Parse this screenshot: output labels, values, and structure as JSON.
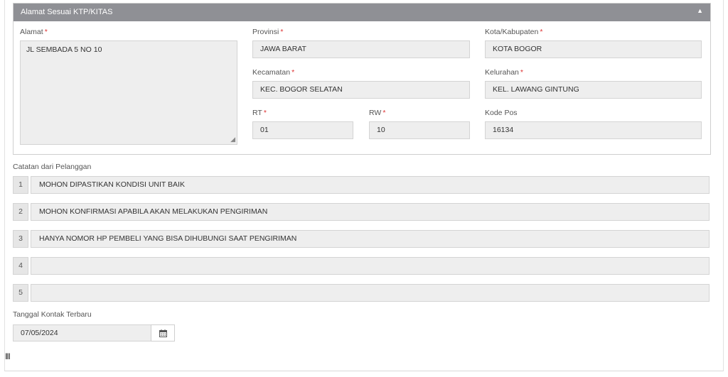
{
  "panel": {
    "title": "Alamat Sesuai KTP/KITAS",
    "collapse_glyph": "▲"
  },
  "address": {
    "alamat_label": "Alamat",
    "alamat_value": "JL SEMBADA 5 NO 10",
    "provinsi_label": "Provinsi",
    "provinsi_value": "JAWA BARAT",
    "kota_label": "Kota/Kabupaten",
    "kota_value": "KOTA BOGOR",
    "kecamatan_label": "Kecamatan",
    "kecamatan_value": "KEC. BOGOR SELATAN",
    "kelurahan_label": "Kelurahan",
    "kelurahan_value": "KEL. LAWANG GINTUNG",
    "rt_label": "RT",
    "rt_value": "01",
    "rw_label": "RW",
    "rw_value": "10",
    "kodepos_label": "Kode Pos",
    "kodepos_value": "16134",
    "required_mark": "*"
  },
  "notes": {
    "label": "Catatan dari Pelanggan",
    "items": [
      {
        "num": "1",
        "text": "MOHON DIPASTIKAN KONDISI UNIT BAIK"
      },
      {
        "num": "2",
        "text": "MOHON KONFIRMASI APABILA AKAN MELAKUKAN PENGIRIMAN"
      },
      {
        "num": "3",
        "text": "HANYA NOMOR HP PEMBELI YANG BISA DIHUBUNGI SAAT PENGIRIMAN"
      },
      {
        "num": "4",
        "text": ""
      },
      {
        "num": "5",
        "text": ""
      }
    ]
  },
  "contact": {
    "label": "Tanggal Kontak Terbaru",
    "date_value": "07/05/2024"
  },
  "icons": {
    "calendar": "calendar-icon",
    "caret": "caret-up-icon"
  },
  "colors": {
    "header_bg": "#8f9095",
    "field_bg": "#eeeeee",
    "required": "#dd3333"
  }
}
